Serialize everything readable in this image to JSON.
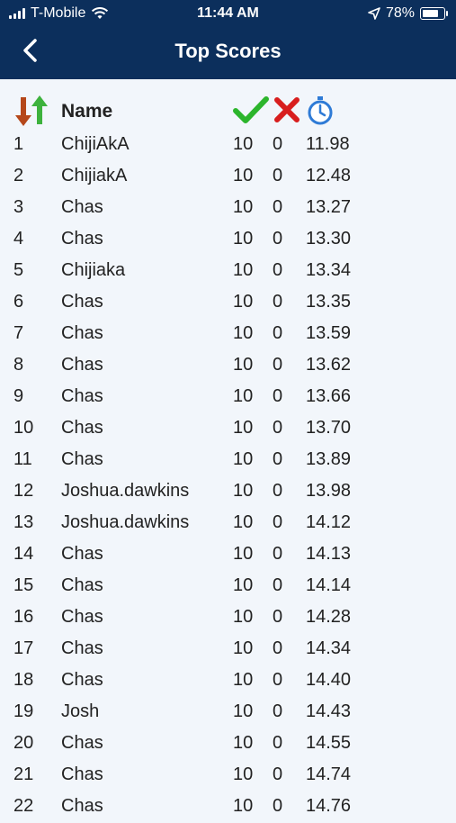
{
  "status_bar": {
    "carrier": "T-Mobile",
    "time": "11:44 AM",
    "battery": "78%",
    "battery_level": 0.78
  },
  "header": {
    "title": "Top Scores",
    "back_icon": "chevron-left-icon"
  },
  "columns": {
    "name": "Name",
    "correct_icon": "checkmark-icon",
    "wrong_icon": "x-icon",
    "time_icon": "stopwatch-icon",
    "sort_icon": "sort-arrows-icon"
  },
  "scores": [
    {
      "rank": "1",
      "name": "ChijiAkA",
      "correct": "10",
      "wrong": "0",
      "time": "11.98"
    },
    {
      "rank": "2",
      "name": "ChijiakA",
      "correct": "10",
      "wrong": "0",
      "time": "12.48"
    },
    {
      "rank": "3",
      "name": "Chas",
      "correct": "10",
      "wrong": "0",
      "time": "13.27"
    },
    {
      "rank": "4",
      "name": "Chas",
      "correct": "10",
      "wrong": "0",
      "time": "13.30"
    },
    {
      "rank": "5",
      "name": "Chijiaka",
      "correct": "10",
      "wrong": "0",
      "time": "13.34"
    },
    {
      "rank": "6",
      "name": "Chas",
      "correct": "10",
      "wrong": "0",
      "time": "13.35"
    },
    {
      "rank": "7",
      "name": "Chas",
      "correct": "10",
      "wrong": "0",
      "time": "13.59"
    },
    {
      "rank": "8",
      "name": "Chas",
      "correct": "10",
      "wrong": "0",
      "time": "13.62"
    },
    {
      "rank": "9",
      "name": "Chas",
      "correct": "10",
      "wrong": "0",
      "time": "13.66"
    },
    {
      "rank": "10",
      "name": "Chas",
      "correct": "10",
      "wrong": "0",
      "time": "13.70"
    },
    {
      "rank": "11",
      "name": "Chas",
      "correct": "10",
      "wrong": "0",
      "time": "13.89"
    },
    {
      "rank": "12",
      "name": "Joshua.dawkins",
      "correct": "10",
      "wrong": "0",
      "time": "13.98"
    },
    {
      "rank": "13",
      "name": "Joshua.dawkins",
      "correct": "10",
      "wrong": "0",
      "time": "14.12"
    },
    {
      "rank": "14",
      "name": "Chas",
      "correct": "10",
      "wrong": "0",
      "time": "14.13"
    },
    {
      "rank": "15",
      "name": "Chas",
      "correct": "10",
      "wrong": "0",
      "time": "14.14"
    },
    {
      "rank": "16",
      "name": "Chas",
      "correct": "10",
      "wrong": "0",
      "time": "14.28"
    },
    {
      "rank": "17",
      "name": "Chas",
      "correct": "10",
      "wrong": "0",
      "time": "14.34"
    },
    {
      "rank": "18",
      "name": "Chas",
      "correct": "10",
      "wrong": "0",
      "time": "14.40"
    },
    {
      "rank": "19",
      "name": "Josh",
      "correct": "10",
      "wrong": "0",
      "time": "14.43"
    },
    {
      "rank": "20",
      "name": "Chas",
      "correct": "10",
      "wrong": "0",
      "time": "14.55"
    },
    {
      "rank": "21",
      "name": "Chas",
      "correct": "10",
      "wrong": "0",
      "time": "14.74"
    },
    {
      "rank": "22",
      "name": "Chas",
      "correct": "10",
      "wrong": "0",
      "time": "14.76"
    }
  ],
  "colors": {
    "header_bg": "#0c2f5c",
    "page_bg": "#f2f6fb",
    "check_green": "#2cb52c",
    "x_red": "#d81e1e",
    "timer_blue": "#2f7bd6",
    "sort_down": "#b5471a",
    "sort_up": "#3db23d"
  }
}
